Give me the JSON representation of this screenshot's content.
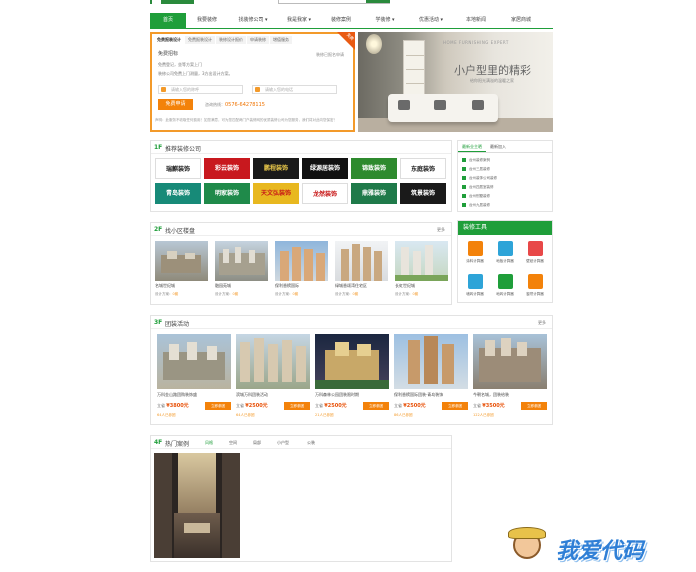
{
  "nav": {
    "items": [
      "首页",
      "我要装修",
      "找装修公司 ▾",
      "我是我家 ▾",
      "装修案例",
      "学装修 ▾",
      "优惠活动 ▾",
      "本地新闻",
      "家居商城"
    ]
  },
  "free": {
    "tabs": [
      "免费报装设计",
      "免费报装设计",
      "装修设计报价",
      "申请装修",
      "增值服务"
    ],
    "corner": "免费",
    "title": "免费招标",
    "title_right": "装修已报名申请",
    "desc1": "免费登记，坐等方案上门",
    "desc2": "装修公司免费上门测量，3方出设计方案。",
    "name_placeholder": "请输入您的称呼",
    "phone_placeholder": "请输入您的电话",
    "apply": "免费申请",
    "hotline_label": "咨询热线：",
    "hotline": "0576-64278115",
    "note": "声明：此服务不收取任何费用！如您满意，可为您匹配两门户装修网的优质装修公司为您服务，我们将对此向您保密！"
  },
  "banner": {
    "line1": "HOME FURNISHING EXPERT",
    "line2": "小户型里的精彩",
    "line3": "给你阳光满溢的温暖之家"
  },
  "sec1": {
    "floor": "1F",
    "title": "推荐装修公司"
  },
  "companies": [
    {
      "name": "瑞麒装饰",
      "bg": "#ffffff",
      "fg": "#222222"
    },
    {
      "name": "彩云装饰",
      "bg": "#c8181e",
      "fg": "#ffffff"
    },
    {
      "name": "鹏程装饰",
      "bg": "#1a1a1a",
      "fg": "#e9c84a"
    },
    {
      "name": "绿源居装饰",
      "bg": "#111111",
      "fg": "#ffffff"
    },
    {
      "name": "锦致装饰",
      "bg": "#2e8a2e",
      "fg": "#ffffff"
    },
    {
      "name": "东庭装饰",
      "bg": "#ffffff",
      "fg": "#222222"
    },
    {
      "name": "青岛装饰",
      "bg": "#178a78",
      "fg": "#ffffff"
    },
    {
      "name": "明家装饰",
      "bg": "#1f8a4a",
      "fg": "#ffffff"
    },
    {
      "name": "天文弘装饰",
      "bg": "#e8b820",
      "fg": "#c81818"
    },
    {
      "name": "龙然装饰",
      "bg": "#ffffff",
      "fg": "#c81818"
    },
    {
      "name": "鼎雅装饰",
      "bg": "#1f7a4a",
      "fg": "#ffffff"
    },
    {
      "name": "筑景装饰",
      "bg": "#1a1a1a",
      "fg": "#ffffff"
    }
  ],
  "side": {
    "tabs": [
      "最新业主晒",
      "最新加入"
    ],
    "items": [
      "台州装修案例",
      "台州三居装修",
      "台州装饰公司装修",
      "台州四居室装修",
      "台州别墅装修",
      "台州九居装修"
    ]
  },
  "sec2": {
    "floor": "2F",
    "title": "找小区楼盘",
    "more": "更多"
  },
  "estates": [
    {
      "name": "名城世纪城",
      "label": "设计方案：",
      "count": "0套"
    },
    {
      "name": "融园苑城",
      "label": "设计方案：",
      "count": "0套"
    },
    {
      "name": "保利香槟国际",
      "label": "设计方案：",
      "count": "0套"
    },
    {
      "name": "绿城香颂湾住宅区",
      "label": "设计方案：",
      "count": "0套"
    },
    {
      "name": "长虹世纪城",
      "label": "设计方案：",
      "count": "0套"
    }
  ],
  "tools": {
    "title": "装修工具",
    "items": [
      {
        "label": "涂料计算器",
        "color": "#f3820a"
      },
      {
        "label": "地板计算器",
        "color": "#2ea4d8"
      },
      {
        "label": "壁纸计算器",
        "color": "#e84848"
      },
      {
        "label": "墙砖计算器",
        "color": "#2ea4d8"
      },
      {
        "label": "地砖计算器",
        "color": "#1f9e3a"
      },
      {
        "label": "窗帘计算器",
        "color": "#f3820a"
      }
    ]
  },
  "sec3": {
    "floor": "3F",
    "title": "团装活动",
    "more": "更多"
  },
  "groups": [
    {
      "name": "万科金山路团购装饰盛",
      "price_label": "立省",
      "price": "¥3800元",
      "sign": "立即参团",
      "count": "64人已参团"
    },
    {
      "name": "滨城万科团装活动",
      "price_label": "立省",
      "price": "¥2500元",
      "sign": "立即参团",
      "count": "64人已参团"
    },
    {
      "name": "万科森林公园团装限时期",
      "price_label": "立省",
      "price": "¥2500元",
      "sign": "立即参团",
      "count": "21人已参团"
    },
    {
      "name": "保利香槟国际团装·青岛装饰",
      "price_label": "立省",
      "price": "¥2500元",
      "sign": "立即参团",
      "count": "86人已参团"
    },
    {
      "name": "今朝名城，团装给装",
      "price_label": "立省",
      "price": "¥3500元",
      "sign": "立即参团",
      "count": "122人已参团"
    }
  ],
  "sec4": {
    "floor": "4F",
    "title": "热门案例",
    "cats": [
      "风格",
      "空间",
      "局部",
      "小户型",
      "公装"
    ]
  },
  "watermark": "我爱代码"
}
